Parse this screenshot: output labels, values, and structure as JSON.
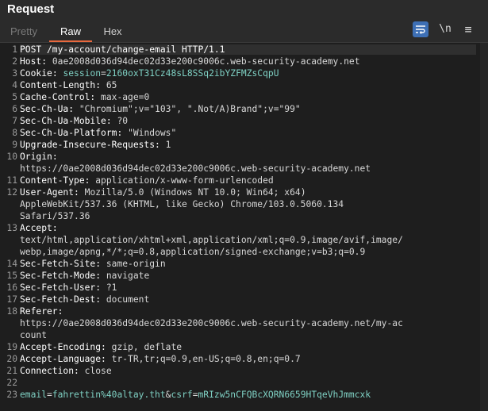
{
  "panel": {
    "title": "Request"
  },
  "tabs": [
    {
      "label": "Pretty"
    },
    {
      "label": "Raw"
    },
    {
      "label": "Hex"
    }
  ],
  "toolbar": {
    "newline_label": "\\n",
    "menu_label": "≡"
  },
  "lines": [
    {
      "n": "1",
      "text": "POST /my-account/change-email HTTP/1.1"
    },
    {
      "n": "2",
      "key": "Host",
      "val": "0ae2008d036d94dec02d33e200c9006c.web-security-academy.net"
    },
    {
      "n": "3",
      "key": "Cookie",
      "cookie_name": "session",
      "cookie_val": "2160oxT31Cz48sL8SSq2ibYZFMZsCqpU"
    },
    {
      "n": "4",
      "key": "Content-Length",
      "val": "65"
    },
    {
      "n": "5",
      "key": "Cache-Control",
      "val": "max-age=0"
    },
    {
      "n": "6",
      "key": "Sec-Ch-Ua",
      "val": "\"Chromium\";v=\"103\", \".Not/A)Brand\";v=\"99\""
    },
    {
      "n": "7",
      "key": "Sec-Ch-Ua-Mobile",
      "val": "?0"
    },
    {
      "n": "8",
      "key": "Sec-Ch-Ua-Platform",
      "val": "\"Windows\""
    },
    {
      "n": "9",
      "key": "Upgrade-Insecure-Requests",
      "val": "1"
    },
    {
      "n": "10",
      "key": "Origin",
      "val": "",
      "cont": [
        "https://0ae2008d036d94dec02d33e200c9006c.web-security-academy.net"
      ]
    },
    {
      "n": "11",
      "key": "Content-Type",
      "val": "application/x-www-form-urlencoded"
    },
    {
      "n": "12",
      "key": "User-Agent",
      "val": "Mozilla/5.0 (Windows NT 10.0; Win64; x64)",
      "cont": [
        "AppleWebKit/537.36 (KHTML, like Gecko) Chrome/103.0.5060.134",
        "Safari/537.36"
      ]
    },
    {
      "n": "13",
      "key": "Accept",
      "val": "",
      "cont": [
        "text/html,application/xhtml+xml,application/xml;q=0.9,image/avif,image/",
        "webp,image/apng,*/*;q=0.8,application/signed-exchange;v=b3;q=0.9"
      ]
    },
    {
      "n": "14",
      "key": "Sec-Fetch-Site",
      "val": "same-origin"
    },
    {
      "n": "15",
      "key": "Sec-Fetch-Mode",
      "val": "navigate"
    },
    {
      "n": "16",
      "key": "Sec-Fetch-User",
      "val": "?1"
    },
    {
      "n": "17",
      "key": "Sec-Fetch-Dest",
      "val": "document"
    },
    {
      "n": "18",
      "key": "Referer",
      "val": "",
      "cont": [
        "https://0ae2008d036d94dec02d33e200c9006c.web-security-academy.net/my-ac",
        "count"
      ]
    },
    {
      "n": "19",
      "key": "Accept-Encoding",
      "val": "gzip, deflate"
    },
    {
      "n": "20",
      "key": "Accept-Language",
      "val": "tr-TR,tr;q=0.9,en-US;q=0.8,en;q=0.7"
    },
    {
      "n": "21",
      "key": "Connection",
      "val": "close"
    },
    {
      "n": "22",
      "text": ""
    },
    {
      "n": "23",
      "body": [
        {
          "k": "email",
          "v": "fahrettin%40altay.tht"
        },
        {
          "k": "csrf",
          "v": "mRIzw5nCFQBcXQRN6659HTqeVhJmmcxk"
        }
      ]
    }
  ]
}
